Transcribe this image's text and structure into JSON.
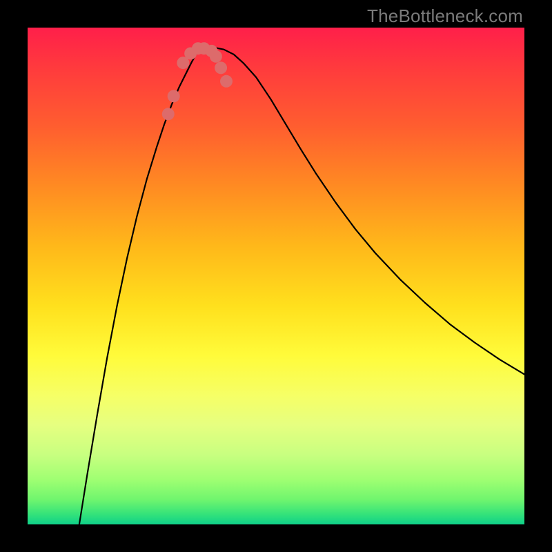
{
  "watermark": "TheBottleneck.com",
  "chart_data": {
    "type": "line",
    "title": "",
    "xlabel": "",
    "ylabel": "",
    "xlim": [
      0,
      100
    ],
    "ylim": [
      0,
      100
    ],
    "legend": false,
    "grid": false,
    "series": [
      {
        "name": "bottleneck-curve",
        "color": "#000000",
        "x_pct": [
          10.4,
          12,
          14,
          16,
          18,
          20,
          22,
          24,
          26,
          27.5,
          29,
          30.5,
          32,
          33,
          34,
          35,
          36,
          37.5,
          39.5,
          41.5,
          43.5,
          46,
          49,
          52,
          55,
          58,
          62,
          66,
          70,
          75,
          80,
          85,
          90,
          95,
          100
        ],
        "y_plot": [
          0,
          10,
          22,
          33.5,
          44,
          53.5,
          62,
          69.5,
          76,
          80.5,
          84.5,
          88,
          91,
          93,
          94.8,
          95.6,
          96,
          96,
          95.6,
          94.6,
          92.8,
          90,
          85.5,
          80.5,
          75.5,
          70.7,
          64.8,
          59.4,
          54.6,
          49.3,
          44.6,
          40.3,
          36.6,
          33.2,
          30.2
        ]
      }
    ],
    "markers": {
      "name": "pink-data-points",
      "color": "#dd6b6b",
      "x_pct": [
        28.3,
        29.4,
        31.3,
        32.8,
        34.3,
        35.5,
        37.0,
        37.9,
        38.9,
        40.0
      ],
      "y_plot": [
        82.6,
        86.2,
        92.9,
        94.8,
        95.8,
        95.8,
        95.3,
        94.2,
        91.9,
        89.2
      ],
      "radius_px": 9
    },
    "colors": {
      "background_top": "#ff1f4a",
      "background_bottom": "#0fd089",
      "curve": "#000000",
      "marker": "#dd6b6b",
      "frame": "#000000",
      "watermark": "#7a7a7a"
    }
  }
}
